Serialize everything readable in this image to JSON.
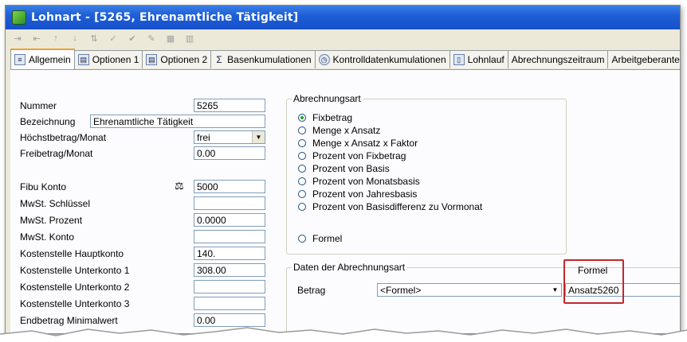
{
  "window": {
    "title": "Lohnart - [5265, Ehrenamtliche Tätigkeit]"
  },
  "toolbar": {
    "icons": [
      "indent-icon",
      "outdent-icon",
      "move-up-icon",
      "move-down-icon",
      "sort-icon",
      "spellcheck-icon",
      "spellcheck-options-icon",
      "edit-icon",
      "grid-icon",
      "grid-options-icon"
    ]
  },
  "tabs": [
    {
      "label": "Allgemein",
      "icon": "page-icon",
      "active": true
    },
    {
      "label": "Optionen 1",
      "icon": "options-icon"
    },
    {
      "label": "Optionen 2",
      "icon": "options-icon"
    },
    {
      "label": "Basenkumulationen",
      "icon": "sigma-icon"
    },
    {
      "label": "Kontrolldatenkumulationen",
      "icon": "clock-icon"
    },
    {
      "label": "Lohnlauf",
      "icon": "document-icon"
    },
    {
      "label": "Abrechnungszeitraum",
      "icon": ""
    },
    {
      "label": "Arbeitgeberanteil",
      "icon": ""
    }
  ],
  "left_form": {
    "nummer_label": "Nummer",
    "nummer_value": "5265",
    "bezeichnung_label": "Bezeichnung",
    "bezeichnung_value": "Ehrenamtliche Tätigkeit",
    "hoechstbetrag_label": "Höchstbetrag/Monat",
    "hoechstbetrag_value": "frei",
    "freibetrag_label": "Freibetrag/Monat",
    "freibetrag_value": "0.00",
    "fibu_label": "Fibu Konto",
    "fibu_value": "5000",
    "mwst_schluessel_label": "MwSt. Schlüssel",
    "mwst_schluessel_value": "",
    "mwst_prozent_label": "MwSt. Prozent",
    "mwst_prozent_value": "0.0000",
    "mwst_konto_label": "MwSt. Konto",
    "mwst_konto_value": "",
    "ks_haupt_label": "Kostenstelle Hauptkonto",
    "ks_haupt_value": "140.",
    "ks_unter1_label": "Kostenstelle Unterkonto 1",
    "ks_unter1_value": "308.00",
    "ks_unter2_label": "Kostenstelle Unterkonto 2",
    "ks_unter2_value": "",
    "ks_unter3_label": "Kostenstelle Unterkonto 3",
    "ks_unter3_value": "",
    "endbetrag_label": "Endbetrag Minimalwert",
    "endbetrag_value": "0.00"
  },
  "abrechnungsart": {
    "title": "Abrechnungsart",
    "options": [
      {
        "label": "Fixbetrag",
        "selected": true
      },
      {
        "label": "Menge x Ansatz",
        "selected": false
      },
      {
        "label": "Menge x Ansatz x Faktor",
        "selected": false
      },
      {
        "label": "Prozent von Fixbetrag",
        "selected": false
      },
      {
        "label": "Prozent von Basis",
        "selected": false
      },
      {
        "label": "Prozent von Monatsbasis",
        "selected": false
      },
      {
        "label": "Prozent von Jahresbasis",
        "selected": false
      },
      {
        "label": "Prozent von Basisdifferenz zu Vormonat",
        "selected": false
      }
    ],
    "formel_option": "Formel"
  },
  "daten": {
    "title": "Daten der Abrechnungsart",
    "formel_header": "Formel",
    "betrag_label": "Betrag",
    "betrag_value": "<Formel>",
    "formel_value": "Ansatz5260"
  },
  "colors": {
    "titlebar": "#1e5fd8",
    "highlight": "#c0282c",
    "tab_active_accent": "#f0a030"
  }
}
